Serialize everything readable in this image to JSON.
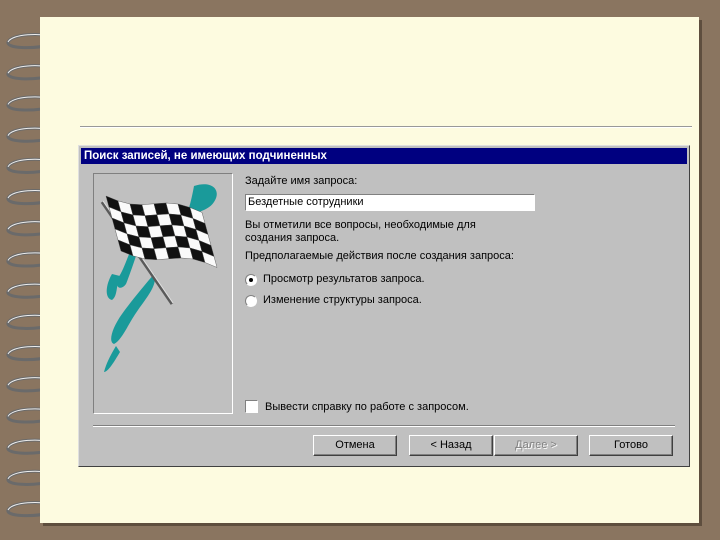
{
  "dialog": {
    "title": "Поиск записей, не имеющих подчиненных",
    "name_prompt": "Задайте имя запроса:",
    "query_name_value": "Бездетные сотрудники",
    "info_line1": "Вы отметили все вопросы, необходимые для",
    "info_line2": "создания запроса.",
    "after_prompt": "Предполагаемые действия после создания запроса:",
    "options": [
      {
        "label": "Просмотр результатов запроса.",
        "selected": true
      },
      {
        "label": "Изменение структуры запроса.",
        "selected": false
      }
    ],
    "help_checkbox_label": "Вывести справку по работе с запросом.",
    "help_checked": false,
    "buttons": {
      "cancel": "Отмена",
      "back": "< Назад",
      "next": "Далее >",
      "finish": "Готово"
    }
  },
  "colors": {
    "title_bar": "#000080",
    "dialog_face": "#c0c0c0",
    "flag_accent": "#1a9a9a",
    "paper": "#fdfbe0",
    "background": "#8a7560"
  },
  "icons": {
    "wizard_image": "checkered-flag"
  }
}
